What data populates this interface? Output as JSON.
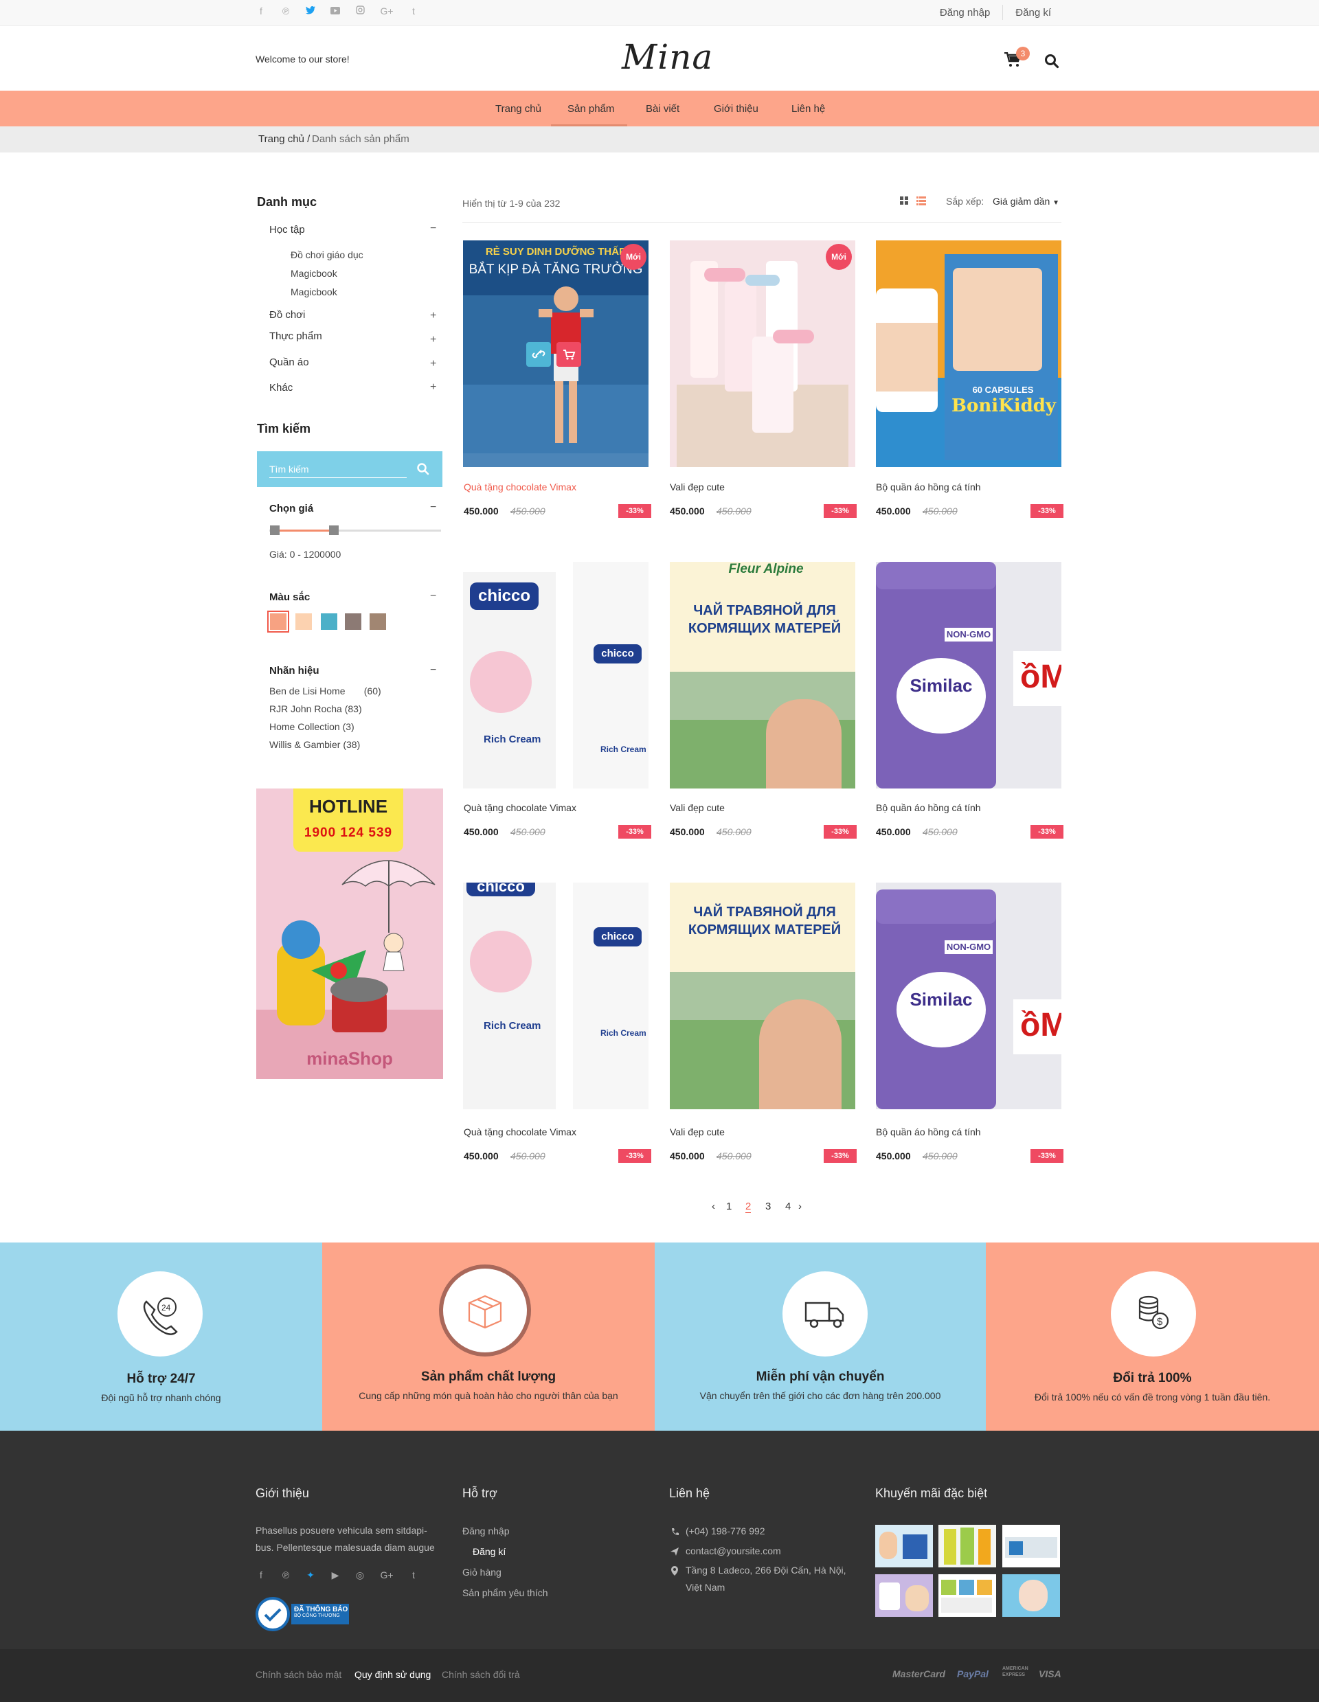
{
  "topbar": {
    "social_icons": [
      "facebook-icon",
      "pinterest-icon",
      "twitter-icon",
      "youtube-icon",
      "instagram-icon",
      "google-plus-icon",
      "tumblr-icon"
    ],
    "login": "Đăng nhập",
    "register": "Đăng kí"
  },
  "header": {
    "welcome": "Welcome to our store!",
    "logo": "Mina",
    "cart_count": "3"
  },
  "nav": {
    "items": [
      "Trang chủ",
      "Sản phẩm",
      "Bài viết",
      "Giới thiệu",
      "Liên hệ"
    ],
    "active": "Sản phẩm"
  },
  "breadcrumb": {
    "home": "Trang chủ /",
    "current": "Danh sách sản phẩm"
  },
  "sidebar": {
    "category_title": "Danh mục",
    "categories": [
      {
        "label": "Học tập",
        "toggle": "−"
      },
      {
        "label": "Đồ chơi",
        "toggle": "+"
      },
      {
        "label": "Thực phẩm",
        "toggle": "+"
      },
      {
        "label": "Quần áo",
        "toggle": "+"
      },
      {
        "label": "Khác",
        "toggle": "+"
      }
    ],
    "subcategories": [
      "Đồ chơi giáo dục",
      "Magicbook",
      "Magicbook"
    ],
    "search_title": "Tìm kiếm",
    "search_placeholder": "Tìm kiếm",
    "price_title": "Chọn giá",
    "price_range": "Giá: 0 - 1200000",
    "price_min_fraction": 0.0,
    "price_max_fraction": 0.33,
    "color_title": "Màu  sắc",
    "colors": [
      "#f7a282",
      "#fcd2b0",
      "#4bb0c8",
      "#8c7a74",
      "#a18672"
    ],
    "brand_title": "Nhãn hiệu",
    "brands": [
      {
        "name": "Ben de Lisi Home",
        "count": "(60)"
      },
      {
        "name": "RJR John Rocha",
        "count": "(83)"
      },
      {
        "name": "Home Collection",
        "count": "(3)"
      },
      {
        "name": "Willis & Gambier",
        "count": "(38)"
      }
    ],
    "collapse_sign": "−"
  },
  "banner": {
    "hotline_label": "HOTLINE",
    "phone": "1900 124 539",
    "shop": "minaShop"
  },
  "listing": {
    "count_text": "Hiển thị từ 1-9 của 232",
    "sort_label": "Sắp xếp:",
    "sort_value": "Giá giảm dần"
  },
  "products": [
    {
      "name": "Quà tặng chocolate Vimax",
      "price": "450.000",
      "old": "450.000",
      "discount": "-33%",
      "new": "Mới",
      "img_text_1": "RẺ SUY DINH DƯỠNG THẤP",
      "img_text_2": "BẮT KỊP ĐÀ TĂNG TRƯỞNG"
    },
    {
      "name": "Vali đẹp cute",
      "price": "450.000",
      "old": "450.000",
      "discount": "-33%",
      "new": "Mới",
      "img_text_1": "",
      "img_text_2": ""
    },
    {
      "name": "Bộ quần áo hồng cá tính",
      "price": "450.000",
      "old": "450.000",
      "discount": "-33%",
      "img_text_1": "BoniKiddy",
      "img_text_2": "60 CAPSULES"
    },
    {
      "name": "Quà tặng chocolate Vimax",
      "price": "450.000",
      "old": "450.000",
      "discount": "-33%",
      "img_text_1": "chicco",
      "img_text_2": "Rich Cream"
    },
    {
      "name": "Vali đẹp cute",
      "price": "450.000",
      "old": "450.000",
      "discount": "-33%",
      "img_text_1": "Fleur Alpine",
      "img_text_2": "ЧАЙ ТРАВЯНОЙ ДЛЯ КОРМЯЩИХ МАТЕРЕЙ"
    },
    {
      "name": "Bộ quần áo hồng cá tính",
      "price": "450.000",
      "old": "450.000",
      "discount": "-33%",
      "img_text_1": "NON-GMO",
      "img_text_2": "Similac"
    },
    {
      "name": "Quà tặng chocolate Vimax",
      "price": "450.000",
      "old": "450.000",
      "discount": "-33%",
      "img_text_1": "chicco",
      "img_text_2": "Rich Cream"
    },
    {
      "name": "Vali đẹp cute",
      "price": "450.000",
      "old": "450.000",
      "discount": "-33%",
      "img_text_1": "",
      "img_text_2": "ЧАЙ ТРАВЯНОЙ ДЛЯ КОРМЯЩИХ МАТЕРЕЙ"
    },
    {
      "name": "Bộ quần áo hồng cá tính",
      "price": "450.000",
      "old": "450.000",
      "discount": "-33%",
      "img_text_1": "NON-GMO",
      "img_text_2": "Similac"
    }
  ],
  "pagination": {
    "prev": "‹",
    "pages": [
      "1",
      "2",
      "3",
      "4"
    ],
    "active": "2",
    "next": "›"
  },
  "features": [
    {
      "title": "Hỗ trợ 24/7",
      "desc": "Đội ngũ hỗ trợ nhanh chóng",
      "bg": "#9dd7ec",
      "icon": "phone-24-icon"
    },
    {
      "title": "Sản phẩm chất lượng",
      "desc": "Cung cấp những món quà hoàn hảo cho người thân của bạn",
      "bg": "#fda58a",
      "icon": "gift-box-icon"
    },
    {
      "title": "Miễn phí vận chuyển",
      "desc": "Vận chuyển trên thế giới cho các đơn hàng trên  200.000",
      "bg": "#9dd7ec",
      "icon": "truck-icon"
    },
    {
      "title": "Đổi trả 100%",
      "desc": "Đổi trả 100% nếu có vấn đề trong vòng 1 tuần đầu tiên.",
      "bg": "#fda58a",
      "icon": "coins-icon"
    }
  ],
  "footer": {
    "about_title": "Giới thiệu",
    "about_text_1": "Phasellus posuere vehicula sem sitdapi-",
    "about_text_2": "bus. Pellentesque malesuada diam augue",
    "cert_1": "ĐÃ THÔNG BÁO",
    "cert_2": "BỘ CÔNG THƯƠNG",
    "support_title": "Hỗ trợ",
    "support_links": [
      "Đăng nhập",
      "Đăng kí",
      "Giỏ hàng",
      "Sản phẩm yêu thích"
    ],
    "contact_title": "Liên hệ",
    "phone": "(+04) 198-776 992",
    "email": "contact@yoursite.com",
    "address_1": "Tầng 8 Ladeco, 266 Đội Cấn, Hà Nội,",
    "address_2": "Việt Nam",
    "promo_title": "Khuyến mãi đặc biệt"
  },
  "bottom": {
    "links": [
      "Chính sách bảo mật",
      "Quy định sử dụng",
      "Chính sách đổi trả"
    ],
    "payments": [
      "MasterCard",
      "PayPal",
      "AMERICAN EXPRESS",
      "VISA"
    ]
  },
  "colors": {
    "accent": "#fda58a",
    "sale": "#ef4a62",
    "light_blue": "#9dd7ec",
    "footer": "#333333"
  }
}
